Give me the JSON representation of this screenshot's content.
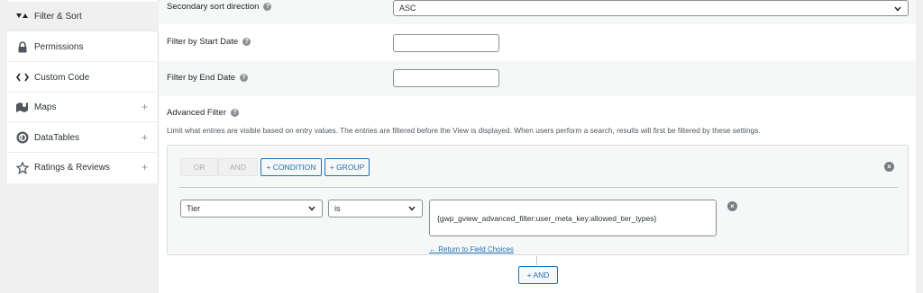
{
  "sidebar": {
    "items": [
      {
        "label": "Filter & Sort",
        "icon": "filter-sort-icon",
        "expandable": false,
        "active": true
      },
      {
        "label": "Permissions",
        "icon": "lock-icon",
        "expandable": false,
        "active": false
      },
      {
        "label": "Custom Code",
        "icon": "code-icon",
        "expandable": false,
        "active": false
      },
      {
        "label": "Maps",
        "icon": "map-icon",
        "expandable": true,
        "active": false
      },
      {
        "label": "DataTables",
        "icon": "datatables-icon",
        "expandable": true,
        "active": false
      },
      {
        "label": "Ratings & Reviews",
        "icon": "star-icon",
        "expandable": true,
        "active": false
      }
    ],
    "expand_symbol": "+"
  },
  "settings": {
    "secondary_sort": {
      "label": "Secondary sort direction",
      "value": "ASC"
    },
    "start_date": {
      "label": "Filter by Start Date",
      "value": ""
    },
    "end_date": {
      "label": "Filter by End Date",
      "value": ""
    },
    "help_symbol": "?"
  },
  "advanced_filter": {
    "title": "Advanced Filter",
    "description": "Limit what entries are visible based on entry values. The entries are filtered before the View is displayed. When users perform a search, results will first be filtered by these settings.",
    "logic": {
      "or_label": "OR",
      "and_label": "AND",
      "add_condition_label": "+ CONDITION",
      "add_group_label": "+ GROUP"
    },
    "condition": {
      "field": "Tier",
      "operator": "is",
      "value": "{gwp_gview_advanced_filter:user_meta_key:allowed_tier_types}"
    },
    "return_link": "← Return to Field Choices",
    "add_and_label": "+ AND",
    "remove_symbol": "×"
  },
  "colors": {
    "accent": "#2271b1",
    "border": "#8c8f94",
    "panel": "#f6f7f7"
  }
}
